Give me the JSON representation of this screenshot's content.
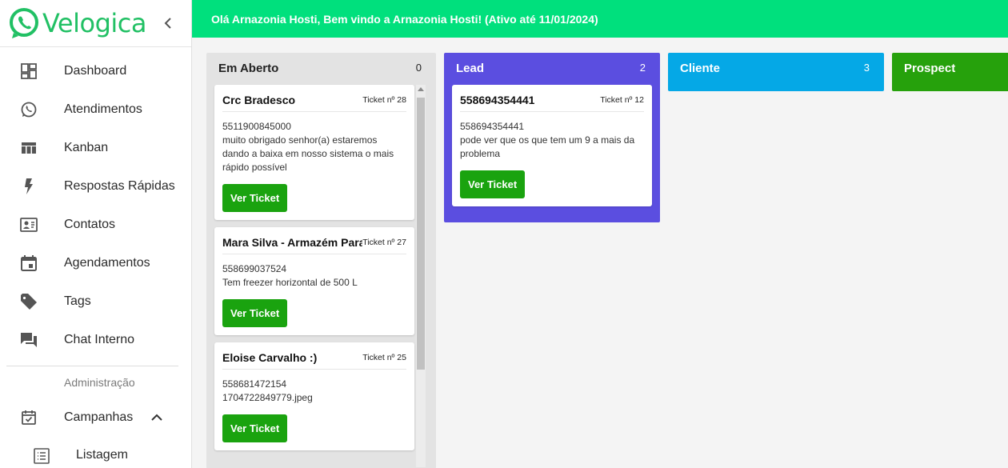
{
  "app": {
    "logo_text": "Velogica",
    "brand_color": "#21c064"
  },
  "topbar": {
    "greeting": "Olá Arnazonia Hosti, Bem vindo a Arnazonia Hosti! (Ativo até 11/01/2024)",
    "color": "#00e07d"
  },
  "sidebar": {
    "items": [
      {
        "label": "Dashboard",
        "icon": "dashboard-icon"
      },
      {
        "label": "Atendimentos",
        "icon": "whatsapp-icon"
      },
      {
        "label": "Kanban",
        "icon": "kanban-icon"
      },
      {
        "label": "Respostas Rápidas",
        "icon": "flash-icon"
      },
      {
        "label": "Contatos",
        "icon": "contact-card-icon"
      },
      {
        "label": "Agendamentos",
        "icon": "calendar-icon"
      },
      {
        "label": "Tags",
        "icon": "tag-icon"
      },
      {
        "label": "Chat Interno",
        "icon": "forum-icon"
      }
    ],
    "admin_section": "Administração",
    "campaigns": {
      "label": "Campanhas",
      "icon": "event-check-icon"
    },
    "listagem": {
      "label": "Listagem",
      "icon": "list-icon"
    }
  },
  "board": {
    "columns": [
      {
        "title": "Em Aberto",
        "count": "0",
        "color": "#e3e3e3",
        "cards": [
          {
            "name": "Crc Bradesco",
            "ticket": "Ticket nº 28",
            "phone": "5511900845000",
            "message": "muito obrigado senhor(a) estaremos dando a baixa em nosso sistema o mais rápido possível",
            "button": "Ver Ticket"
          },
          {
            "name": "Mara Silva - Armazém Paraíba",
            "ticket": "Ticket nº 27",
            "phone": "558699037524",
            "message": "Tem freezer horizontal de 500 L",
            "button": "Ver Ticket"
          },
          {
            "name": "Eloise Carvalho :)",
            "ticket": "Ticket nº 25",
            "phone": "558681472154",
            "message": "1704722849779.jpeg",
            "button": "Ver Ticket"
          }
        ]
      },
      {
        "title": "Lead",
        "count": "2",
        "color": "#5b4ee0",
        "cards": [
          {
            "name": "558694354441",
            "ticket": "Ticket nº 12",
            "phone": "558694354441",
            "message": "pode ver que os que tem um 9 a mais da problema",
            "button": "Ver Ticket"
          }
        ]
      },
      {
        "title": "Cliente",
        "count": "3",
        "color": "#05a8e6"
      },
      {
        "title": "Prospect",
        "count": "",
        "color": "#26a10c"
      }
    ]
  }
}
